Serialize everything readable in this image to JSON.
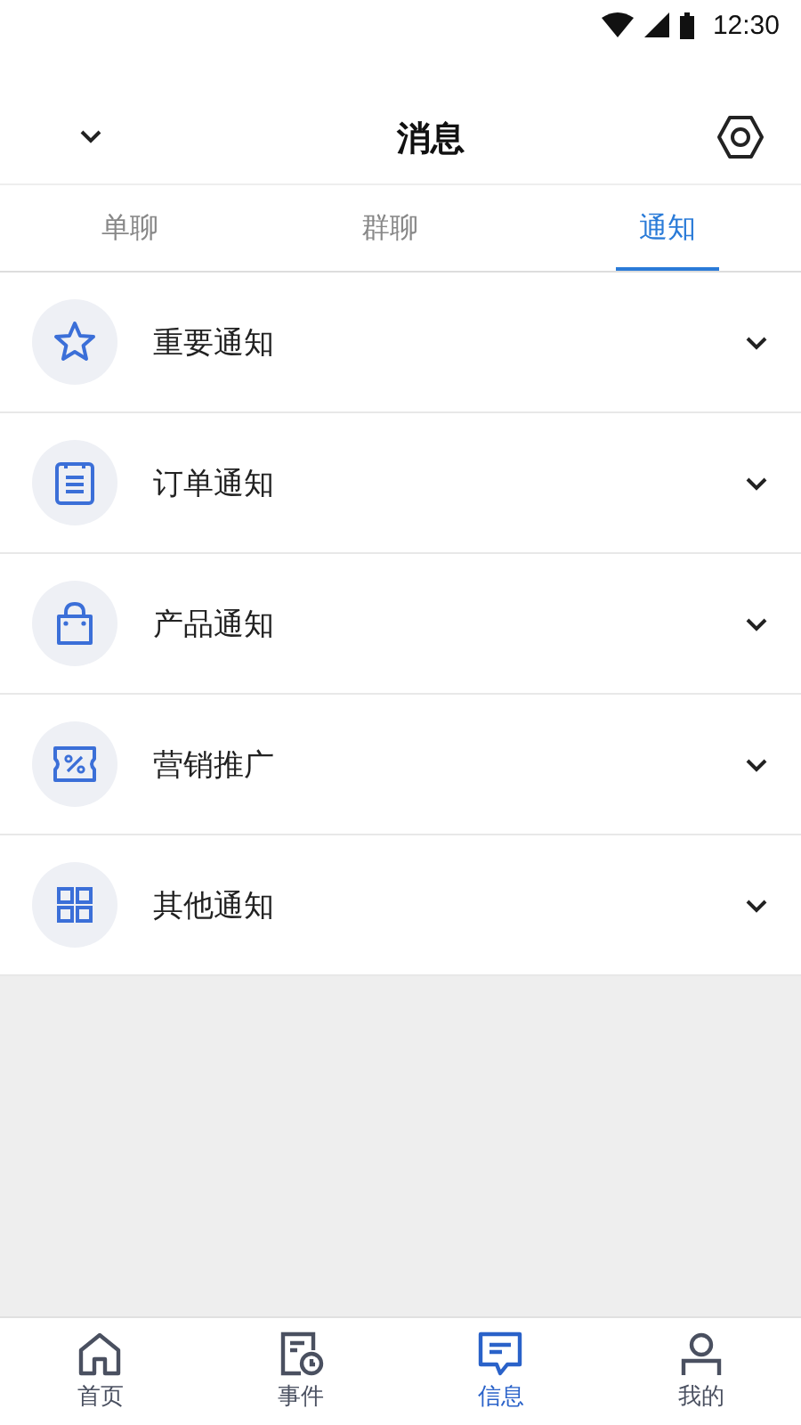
{
  "status_bar": {
    "time": "12:30"
  },
  "header": {
    "title": "消息"
  },
  "tabs": [
    {
      "label": "单聊",
      "selected": false
    },
    {
      "label": "群聊",
      "selected": false
    },
    {
      "label": "通知",
      "selected": true
    }
  ],
  "notifications": [
    {
      "label": "重要通知"
    },
    {
      "label": "订单通知"
    },
    {
      "label": "产品通知"
    },
    {
      "label": "营销推广"
    },
    {
      "label": "其他通知"
    }
  ],
  "bottom_nav": [
    {
      "label": "首页",
      "selected": false
    },
    {
      "label": "事件",
      "selected": false
    },
    {
      "label": "信息",
      "selected": true
    },
    {
      "label": "我的",
      "selected": false
    }
  ]
}
